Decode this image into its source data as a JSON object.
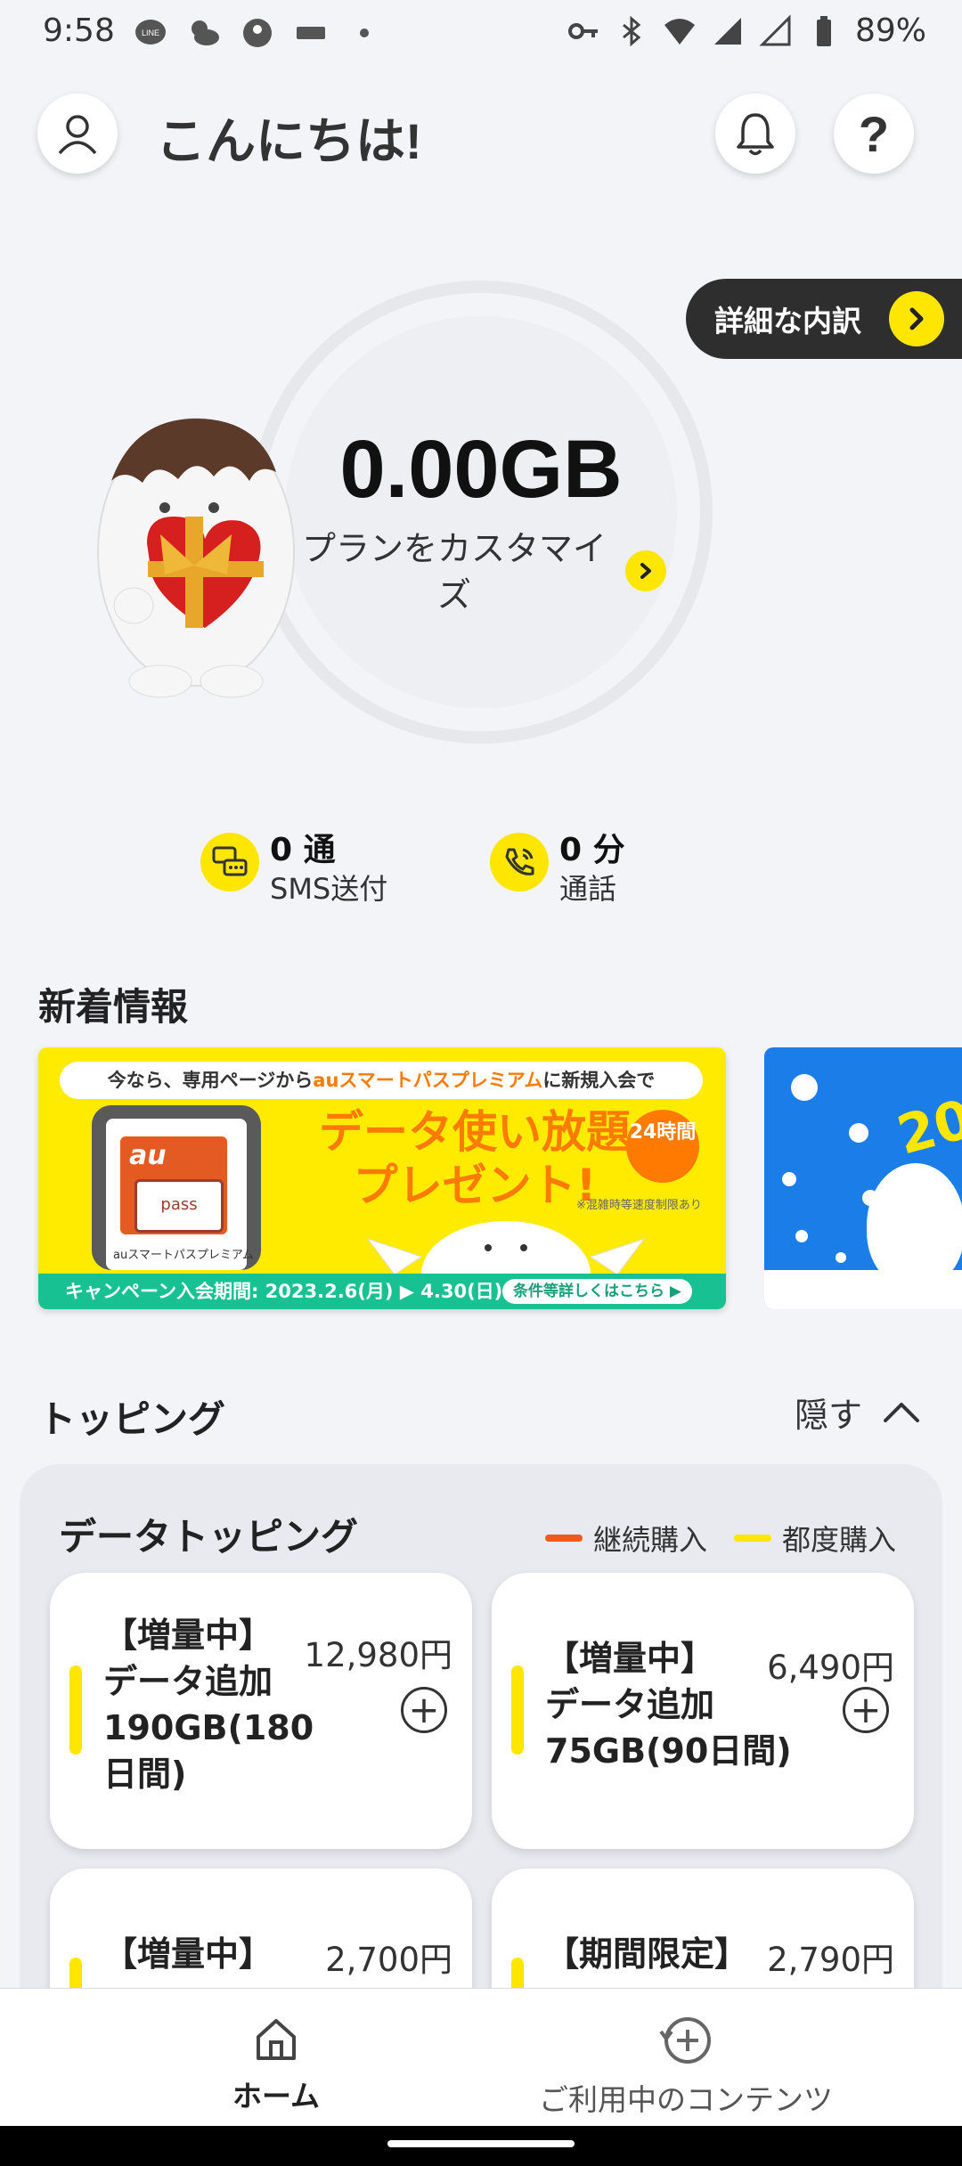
{
  "status_bar": {
    "time": "9:58",
    "battery": "89%",
    "left_icons": [
      "line-icon",
      "weather-icon",
      "app-icon",
      "nitori-icon",
      "dot-icon"
    ],
    "right_icons": [
      "vpn-key-icon",
      "bluetooth-icon",
      "wifi-icon",
      "signal-icon",
      "battery-icon"
    ]
  },
  "header": {
    "greeting": "こんにちは!",
    "help_label": "?"
  },
  "breakdown": {
    "label": "詳細な内訳"
  },
  "data_usage": {
    "amount": "0.00GB",
    "plan_link": "プランをカスタマイズ"
  },
  "stats": {
    "sms": {
      "value": "0 通",
      "label": "SMS送付"
    },
    "call": {
      "value": "0 分",
      "label": "通話"
    }
  },
  "news": {
    "title": "新着情報",
    "banner": {
      "top_prefix": "今なら、専用ページから",
      "top_brand": "auスマートパスプレミアム",
      "top_suffix": "に新規入会で",
      "main_line1": "データ使い放題",
      "main_line2": "プレゼント!",
      "badge": "24時間",
      "note": "※混雑時等速度制限あり",
      "phone_brand": "au",
      "phone_card": "pass",
      "phone_label": "auスマートパスプレミアム",
      "campaign": "キャンペーン入会期間: 2023.2.6(月) ▶ 4.30(日)",
      "conditions": "条件等詳しくはこちら ▶"
    },
    "banner2": {
      "year": "20"
    }
  },
  "topping": {
    "title": "トッピング",
    "hide_label": "隠す",
    "data_topping_title": "データトッピング",
    "legend": [
      {
        "label": "継続購入",
        "color": "#f05a1e"
      },
      {
        "label": "都度購入",
        "color": "#ffe600"
      }
    ],
    "cards": [
      {
        "title": "【増量中】\nデータ追加\n190GB(180\n日間)",
        "price": "12,980円"
      },
      {
        "title": "【増量中】\nデータ追加\n75GB(90日間)",
        "price": "6,490円"
      },
      {
        "title": "【増量中】",
        "price": "2,700円"
      },
      {
        "title": "【期間限定】",
        "price": "2,790円"
      }
    ]
  },
  "bottom_nav": {
    "home": "ホーム",
    "contents": "ご利用中のコンテンツ"
  }
}
